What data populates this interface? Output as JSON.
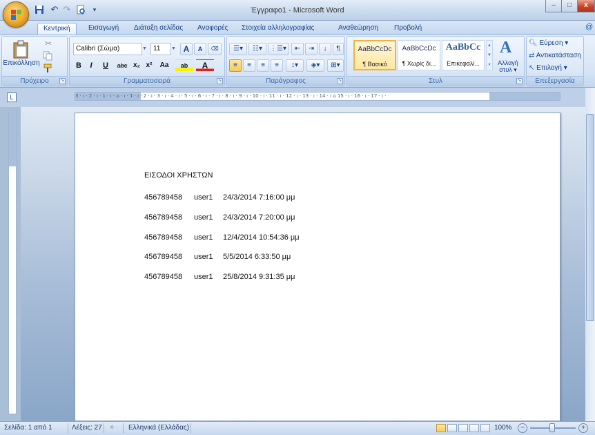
{
  "window": {
    "title": "Έγγραφο1 - Microsoft Word",
    "minimize_glyph": "–",
    "maximize_glyph": "□",
    "close_glyph": "x"
  },
  "quick_access": {
    "save_icon": "save-icon",
    "undo_glyph": "↶",
    "redo_glyph": "↷",
    "customize_glyph": "▾"
  },
  "ribbon_tabs": [
    {
      "label": "Κεντρική",
      "active": true
    },
    {
      "label": "Εισαγωγή",
      "active": false
    },
    {
      "label": "Διάταξη σελίδας",
      "active": false
    },
    {
      "label": "Αναφορές",
      "active": false
    },
    {
      "label": "Στοιχεία αλληλογραφίας",
      "active": false
    },
    {
      "label": "Αναθεώρηση",
      "active": false
    },
    {
      "label": "Προβολή",
      "active": false
    }
  ],
  "help_glyph": "@",
  "clipboard": {
    "group_label": "Πρόχειρο",
    "paste_label": "Επικόλληση"
  },
  "font": {
    "group_label": "Γραμματοσειρά",
    "font_name": "Calibri (Σώμα)",
    "font_size": "11",
    "grow": "A",
    "shrink": "A",
    "bold": "B",
    "italic": "I",
    "underline": "U",
    "strike": "abc",
    "subscript": "x₂",
    "superscript": "x²",
    "case": "Aa",
    "highlight": "ab",
    "font_color": "A"
  },
  "paragraph": {
    "group_label": "Παράγραφος",
    "show_marks": "¶"
  },
  "styles": {
    "group_label": "Στυλ",
    "items": [
      {
        "preview": "AaBbCcDc",
        "name": "¶ Βασικό"
      },
      {
        "preview": "AaBbCcDc",
        "name": "¶ Χωρίς δι..."
      },
      {
        "preview": "AaBbCc",
        "name": "Επικεφαλί..."
      }
    ],
    "change_styles_line1": "Αλλαγή",
    "change_styles_line2": "στυλ ▾"
  },
  "editing": {
    "group_label": "Επεξεργασία",
    "find": "Εύρεση ▾",
    "replace": "Αντικατάσταση",
    "select": "Επιλογή ▾"
  },
  "ruler": {
    "ticks": "3 · ı · 2 · ı · 1 · ı · ⌂ · ı · 1 · ı · 2 · ı · 3 · ı · 4 · ı · 5 · ı · 6 · ı · 7 · ı · 8 · ı · 9 · ı · 10 · ı · 11 · ı · 12 · ı · 13 · ı · 14 · ı ⌂ 15 · ı · 16 · ı · 17 · ı ·",
    "view_ruler_glyph": "L"
  },
  "document": {
    "heading": "ΕΙΣΟΔΟΙ ΧΡΗΣΤΩΝ",
    "rows": [
      {
        "id": "456789458",
        "user": "user1",
        "date": "24/3/2014 7:16:00 μμ"
      },
      {
        "id": "456789458",
        "user": "user1",
        "date": "24/3/2014 7:20:00 μμ"
      },
      {
        "id": "456789458",
        "user": "user1",
        "date": "12/4/2014 10:54:36 μμ"
      },
      {
        "id": "456789458",
        "user": "user1",
        "date": "5/5/2014 6:33:50 μμ"
      },
      {
        "id": "456789458",
        "user": "user1",
        "date": "25/8/2014 9:31:35 μμ"
      }
    ]
  },
  "status": {
    "page": "Σελίδα: 1 από 1",
    "words": "Λέξεις: 27",
    "language": "Ελληνικά (Ελλάδας)",
    "zoom": "100%",
    "zoom_out": "−",
    "zoom_in": "+"
  }
}
